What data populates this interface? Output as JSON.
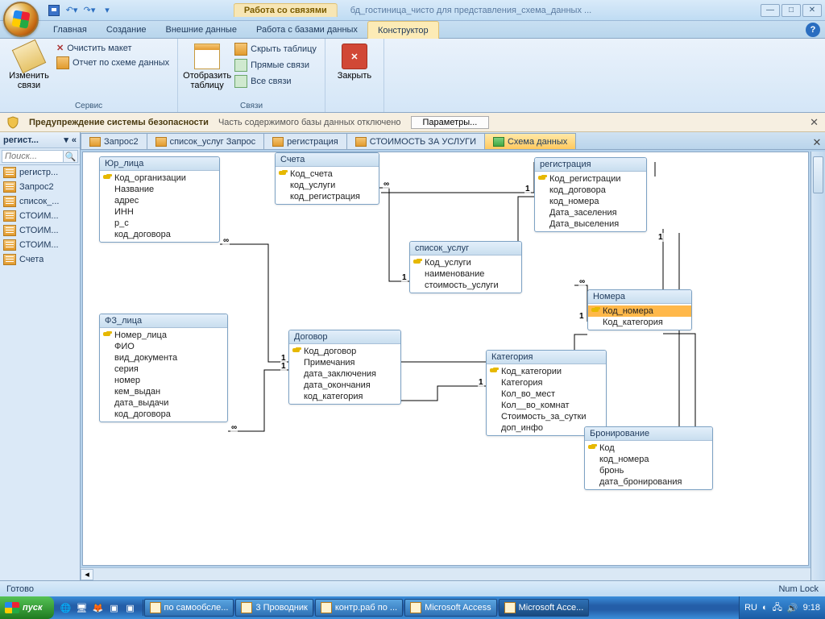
{
  "title": {
    "contextual": "Работа со связями",
    "document": "бд_гостиница_чисто для представления_схема_данных ..."
  },
  "ribbon_tabs": [
    "Главная",
    "Создание",
    "Внешние данные",
    "Работа с базами данных",
    "Конструктор"
  ],
  "ribbon": {
    "group1": {
      "big": "Изменить связи",
      "small1": "Очистить макет",
      "small2": "Отчет по схеме данных",
      "label": "Сервис"
    },
    "group2": {
      "big": "Отобразить таблицу",
      "small1": "Скрыть таблицу",
      "small2": "Прямые связи",
      "small3": "Все связи",
      "label": "Связи"
    },
    "group3": {
      "big": "Закрыть"
    }
  },
  "security": {
    "title": "Предупреждение системы безопасности",
    "msg": "Часть содержимого базы данных отключено",
    "button": "Параметры..."
  },
  "nav": {
    "header": "регист...",
    "search_placeholder": "Поиск...",
    "items": [
      "регистр...",
      "Запрос2",
      "список_...",
      "СТОИМ...",
      "СТОИМ...",
      "СТОИМ...",
      "Счета"
    ]
  },
  "doc_tabs": [
    "Запрос2",
    "список_услуг Запрос",
    "регистрация",
    "СТОИМОСТЬ ЗА УСЛУГИ",
    "Схема данных"
  ],
  "tables": {
    "yur": {
      "title": "Юр_лица",
      "fields": [
        "Код_организации",
        "Название",
        "адрес",
        "ИНН",
        "р_с",
        "код_договора"
      ]
    },
    "fz": {
      "title": "ФЗ_лица",
      "fields": [
        "Номер_лица",
        "ФИО",
        "вид_документа",
        "серия",
        "номер",
        "кем_выдан",
        "дата_выдачи",
        "код_договора"
      ]
    },
    "scheta": {
      "title": "Счета",
      "fields": [
        "Код_счета",
        "код_услуги",
        "код_регистрация"
      ]
    },
    "dogovor": {
      "title": "Договор",
      "fields": [
        "Код_договор",
        "Примечания",
        "дата_заключения",
        "дата_окончания",
        "код_категория"
      ]
    },
    "uslug": {
      "title": "список_услуг",
      "fields": [
        "Код_услуги",
        "наименование",
        "стоимость_услуги"
      ]
    },
    "kateg": {
      "title": "Категория",
      "fields": [
        "Код_категории",
        "Категория",
        "Кол_во_мест",
        "Кол__во_комнат",
        "Стоимость_за_сутки",
        "доп_инфо"
      ]
    },
    "reg": {
      "title": "регистрация",
      "fields": [
        "Код_регистрации",
        "код_договора",
        "код_номера",
        "Дата_заселения",
        "Дата_выселения"
      ]
    },
    "nomera": {
      "title": "Номера",
      "fields": [
        "Код_номера",
        "Код_категория"
      ]
    },
    "bron": {
      "title": "Бронирование",
      "fields": [
        "Код",
        "код_номера",
        "бронь",
        "дата_бронирования"
      ]
    }
  },
  "status": {
    "left": "Готово",
    "right": "Num Lock"
  },
  "taskbar": {
    "start": "пуск",
    "items": [
      {
        "label": "по самообсле..."
      },
      {
        "label": "3 Проводник"
      },
      {
        "label": "контр.раб по ..."
      },
      {
        "label": "Microsoft Access"
      },
      {
        "label": "Microsoft Acce..."
      }
    ],
    "lang": "RU",
    "clock": "9:18"
  }
}
